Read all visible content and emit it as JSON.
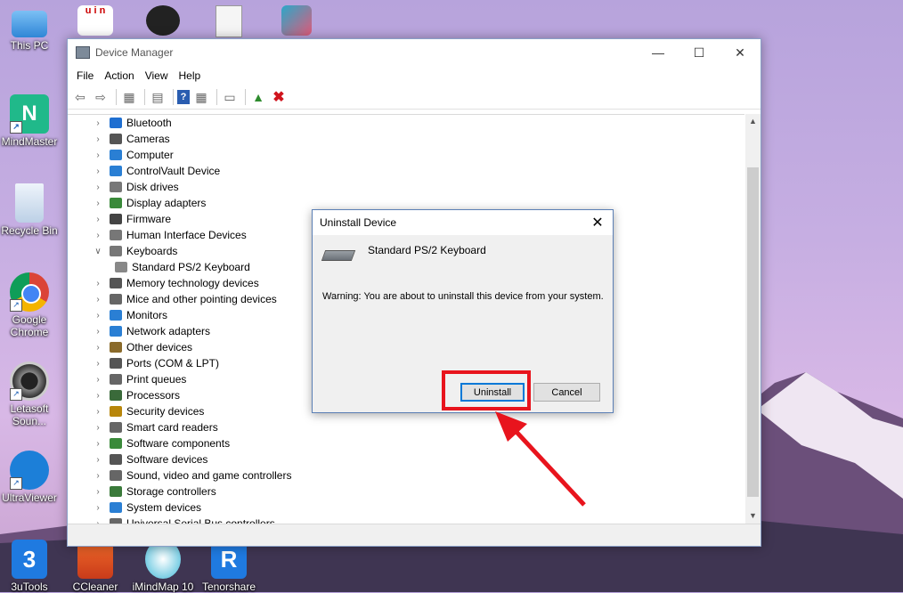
{
  "desktop": {
    "icons": [
      {
        "label": "This PC",
        "icon": "computer-icon"
      },
      {
        "label": "MindMaster",
        "icon": "mindmaster-icon"
      },
      {
        "label": "Recycle Bin",
        "icon": "recycle-bin-icon"
      },
      {
        "label": "Google Chrome",
        "icon": "chrome-icon"
      },
      {
        "label": "Letasoft Soun...",
        "icon": "speaker-icon"
      },
      {
        "label": "UltraViewer",
        "icon": "ultraviewer-icon"
      },
      {
        "label": "3uTools",
        "icon": "3utools-icon"
      },
      {
        "label": "CCleaner",
        "icon": "ccleaner-icon"
      },
      {
        "label": "iMindMap 10",
        "icon": "imindmap-icon"
      },
      {
        "label": "Tenorshare",
        "icon": "tenorshare-icon"
      }
    ]
  },
  "window": {
    "title": "Device Manager",
    "menu": [
      "File",
      "Action",
      "View",
      "Help"
    ],
    "toolbar": [
      "back-icon",
      "forward-icon",
      "properties-icon",
      "show-hide-icon",
      "help-icon",
      "view-icon",
      "scan-icon",
      "update-driver-icon",
      "uninstall-icon"
    ]
  },
  "tree": [
    {
      "label": "Bluetooth",
      "expanded": false,
      "color": "#1f6fd1"
    },
    {
      "label": "Cameras",
      "expanded": false,
      "color": "#555555"
    },
    {
      "label": "Computer",
      "expanded": false,
      "color": "#2a7fd4"
    },
    {
      "label": "ControlVault Device",
      "expanded": false,
      "color": "#2a7fd4"
    },
    {
      "label": "Disk drives",
      "expanded": false,
      "color": "#777777"
    },
    {
      "label": "Display adapters",
      "expanded": false,
      "color": "#3a8a3a"
    },
    {
      "label": "Firmware",
      "expanded": false,
      "color": "#444444"
    },
    {
      "label": "Human Interface Devices",
      "expanded": false,
      "color": "#777777"
    },
    {
      "label": "Keyboards",
      "expanded": true,
      "color": "#777777"
    },
    {
      "label": "Standard PS/2 Keyboard",
      "child": true,
      "color": "#888888"
    },
    {
      "label": "Memory technology devices",
      "expanded": false,
      "color": "#555555"
    },
    {
      "label": "Mice and other pointing devices",
      "expanded": false,
      "color": "#666666"
    },
    {
      "label": "Monitors",
      "expanded": false,
      "color": "#2a7fd4"
    },
    {
      "label": "Network adapters",
      "expanded": false,
      "color": "#2a7fd4"
    },
    {
      "label": "Other devices",
      "expanded": false,
      "color": "#8a6a2a"
    },
    {
      "label": "Ports (COM & LPT)",
      "expanded": false,
      "color": "#555555"
    },
    {
      "label": "Print queues",
      "expanded": false,
      "color": "#666666"
    },
    {
      "label": "Processors",
      "expanded": false,
      "color": "#3a6a3a"
    },
    {
      "label": "Security devices",
      "expanded": false,
      "color": "#b8860b"
    },
    {
      "label": "Smart card readers",
      "expanded": false,
      "color": "#666666"
    },
    {
      "label": "Software components",
      "expanded": false,
      "color": "#3a8a3a"
    },
    {
      "label": "Software devices",
      "expanded": false,
      "color": "#555555"
    },
    {
      "label": "Sound, video and game controllers",
      "expanded": false,
      "color": "#666666"
    },
    {
      "label": "Storage controllers",
      "expanded": false,
      "color": "#3a7a3a"
    },
    {
      "label": "System devices",
      "expanded": false,
      "color": "#2a7fd4"
    },
    {
      "label": "Universal Serial Bus controllers",
      "expanded": false,
      "color": "#666666"
    }
  ],
  "dialog": {
    "title": "Uninstall Device",
    "device_name": "Standard PS/2 Keyboard",
    "warning": "Warning: You are about to uninstall this device from your system.",
    "uninstall_label": "Uninstall",
    "cancel_label": "Cancel"
  },
  "annotation": {
    "highlight_color": "#e8141d"
  }
}
